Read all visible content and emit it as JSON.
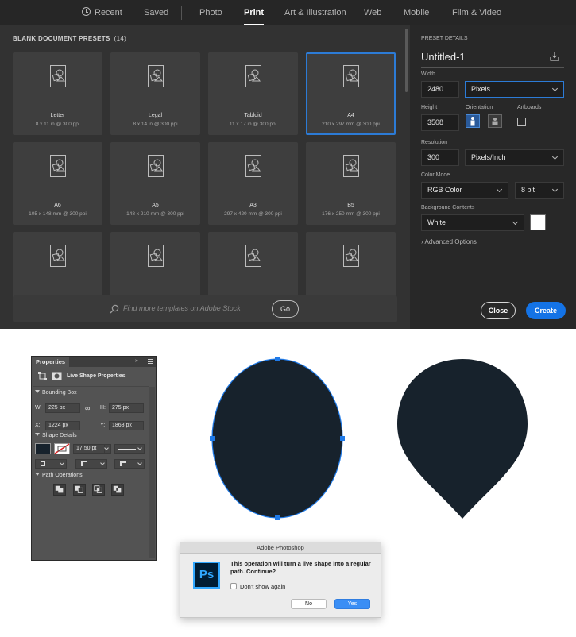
{
  "tabs": [
    {
      "label": "Recent",
      "icon": "clock-icon"
    },
    {
      "label": "Saved"
    },
    {
      "label": "Photo"
    },
    {
      "label": "Print",
      "active": true
    },
    {
      "label": "Art & Illustration"
    },
    {
      "label": "Web"
    },
    {
      "label": "Mobile"
    },
    {
      "label": "Film & Video"
    }
  ],
  "presets": {
    "title": "BLANK DOCUMENT PRESETS",
    "count": "(14)",
    "items": [
      {
        "name": "Letter",
        "size": "8 x 11 in @ 300 ppi"
      },
      {
        "name": "Legal",
        "size": "8 x 14 in @ 300 ppi"
      },
      {
        "name": "Tabloid",
        "size": "11 x 17 in @ 300 ppi"
      },
      {
        "name": "A4",
        "size": "210 x 297 mm @ 300 ppi",
        "selected": true
      },
      {
        "name": "A6",
        "size": "105 x 148 mm @ 300 ppi"
      },
      {
        "name": "A5",
        "size": "148 x 210 mm @ 300 ppi"
      },
      {
        "name": "A3",
        "size": "297 x 420 mm @ 300 ppi"
      },
      {
        "name": "B5",
        "size": "176 x 250 mm @ 300 ppi"
      }
    ]
  },
  "stock": {
    "placeholder": "Find more templates on Adobe Stock",
    "go_label": "Go"
  },
  "details": {
    "title": "PRESET DETAILS",
    "doc_name": "Untitled-1",
    "width_label": "Width",
    "width_value": "2480",
    "width_unit": "Pixels",
    "height_label": "Height",
    "height_value": "3508",
    "orientation_label": "Orientation",
    "artboards_label": "Artboards",
    "resolution_label": "Resolution",
    "resolution_value": "300",
    "resolution_unit": "Pixels/Inch",
    "color_mode_label": "Color Mode",
    "color_mode_value": "RGB Color",
    "bit_depth": "8 bit",
    "background_label": "Background Contents",
    "background_value": "White",
    "advanced_label": "Advanced Options",
    "close_label": "Close",
    "create_label": "Create"
  },
  "properties": {
    "tab_label": "Properties",
    "collapse": "»",
    "subtitle": "Live Shape Properties",
    "bounding_box_label": "Bounding Box",
    "w_label": "W:",
    "w_value": "225 px",
    "link_icon": "∞",
    "h_label": "H:",
    "h_value": "275 px",
    "x_label": "X:",
    "x_value": "1224 px",
    "y_label": "Y:",
    "y_value": "1868 px",
    "shape_details_label": "Shape Details",
    "stroke_width": "17,50 pt",
    "path_operations_label": "Path Operations"
  },
  "colors": {
    "shape_fill": "#17222c",
    "selection": "#1f7ae8",
    "accent": "#1473e6"
  },
  "alert": {
    "title": "Adobe Photoshop",
    "logo_text": "Ps",
    "message": "This operation will turn a live shape into a regular path. Continue?",
    "checkbox_label": "Don't show again",
    "no_label": "No",
    "yes_label": "Yes"
  }
}
